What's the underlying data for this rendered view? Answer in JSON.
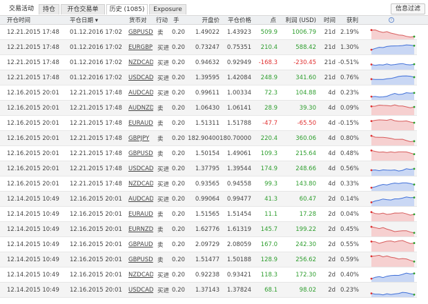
{
  "tabs": [
    "交易活动",
    "持仓",
    "开仓交易单",
    "历史 (1085)",
    "Exposure"
  ],
  "filter_button": "信息过滤",
  "columns": [
    "开仓时间",
    "平仓日期 ▾",
    "货币对",
    "行动",
    "手",
    "开盘价",
    "平仓价格",
    "点",
    "利润 (USD)",
    "时间",
    "获利"
  ],
  "rows": [
    [
      "12.21.2015 17:48",
      "01.12.2016 17:02",
      "GBPUSD",
      "卖",
      "0.20",
      "1.49022",
      "1.43923",
      "509.9",
      "1006.79",
      "21d",
      "2.19%"
    ],
    [
      "12.21.2015 17:48",
      "01.12.2016 17:02",
      "EURGBP",
      "买进",
      "0.20",
      "0.73247",
      "0.75351",
      "210.4",
      "588.42",
      "21d",
      "1.30%"
    ],
    [
      "12.21.2015 17:48",
      "01.12.2016 17:02",
      "NZDCAD",
      "买进",
      "0.20",
      "0.94632",
      "0.92949",
      "-168.3",
      "-230.45",
      "21d",
      "-0.51%"
    ],
    [
      "12.21.2015 17:48",
      "01.12.2016 17:02",
      "USDCAD",
      "买进",
      "0.20",
      "1.39595",
      "1.42084",
      "248.9",
      "341.60",
      "21d",
      "0.76%"
    ],
    [
      "12.16.2015 20:01",
      "12.21.2015 17:48",
      "AUDCAD",
      "买进",
      "0.20",
      "0.99611",
      "1.00334",
      "72.3",
      "104.88",
      "4d",
      "0.23%"
    ],
    [
      "12.16.2015 20:01",
      "12.21.2015 17:48",
      "AUDNZD",
      "卖",
      "0.20",
      "1.06430",
      "1.06141",
      "28.9",
      "39.30",
      "4d",
      "0.09%"
    ],
    [
      "12.16.2015 20:01",
      "12.21.2015 17:48",
      "EURAUD",
      "卖",
      "0.20",
      "1.51311",
      "1.51788",
      "-47.7",
      "-65.50",
      "4d",
      "-0.15%"
    ],
    [
      "12.16.2015 20:01",
      "12.21.2015 17:48",
      "GBPJPY",
      "卖",
      "0.20",
      "182.90400",
      "180.70000",
      "220.4",
      "360.06",
      "4d",
      "0.80%"
    ],
    [
      "12.16.2015 20:01",
      "12.21.2015 17:48",
      "GBPUSD",
      "卖",
      "0.20",
      "1.50154",
      "1.49061",
      "109.3",
      "215.64",
      "4d",
      "0.48%"
    ],
    [
      "12.16.2015 20:01",
      "12.21.2015 17:48",
      "USDCAD",
      "买进",
      "0.20",
      "1.37795",
      "1.39544",
      "174.9",
      "248.66",
      "4d",
      "0.56%"
    ],
    [
      "12.16.2015 20:01",
      "12.21.2015 17:48",
      "NZDCAD",
      "买进",
      "0.20",
      "0.93565",
      "0.94558",
      "99.3",
      "143.80",
      "4d",
      "0.33%"
    ],
    [
      "12.14.2015 10:49",
      "12.16.2015 20:01",
      "AUDCAD",
      "买进",
      "0.20",
      "0.99064",
      "0.99477",
      "41.3",
      "60.47",
      "2d",
      "0.14%"
    ],
    [
      "12.14.2015 10:49",
      "12.16.2015 20:01",
      "EURAUD",
      "卖",
      "0.20",
      "1.51565",
      "1.51454",
      "11.1",
      "17.28",
      "2d",
      "0.04%"
    ],
    [
      "12.14.2015 10:49",
      "12.16.2015 20:01",
      "EURNZD",
      "卖",
      "0.20",
      "1.62776",
      "1.61319",
      "145.7",
      "199.22",
      "2d",
      "0.45%"
    ],
    [
      "12.14.2015 10:49",
      "12.16.2015 20:01",
      "GBPAUD",
      "卖",
      "0.20",
      "2.09729",
      "2.08059",
      "167.0",
      "242.30",
      "2d",
      "0.55%"
    ],
    [
      "12.14.2015 10:49",
      "12.16.2015 20:01",
      "GBPUSD",
      "卖",
      "0.20",
      "1.51477",
      "1.50188",
      "128.9",
      "256.62",
      "2d",
      "0.59%"
    ],
    [
      "12.14.2015 10:49",
      "12.16.2015 20:01",
      "NZDCAD",
      "买进",
      "0.20",
      "0.92238",
      "0.93421",
      "118.3",
      "172.30",
      "2d",
      "0.40%"
    ],
    [
      "12.14.2015 10:49",
      "12.16.2015 20:01",
      "USDCAD",
      "买进",
      "0.20",
      "1.37143",
      "1.37824",
      "68.1",
      "98.02",
      "2d",
      "0.23%"
    ]
  ],
  "colors": {
    "positive": "#2e9e2e",
    "negative": "#e03030",
    "buy_fill": "#c9d7f4",
    "buy_line": "#3f6fd8",
    "sell_fill": "#f6d0d0",
    "sell_line": "#d65a5a"
  }
}
